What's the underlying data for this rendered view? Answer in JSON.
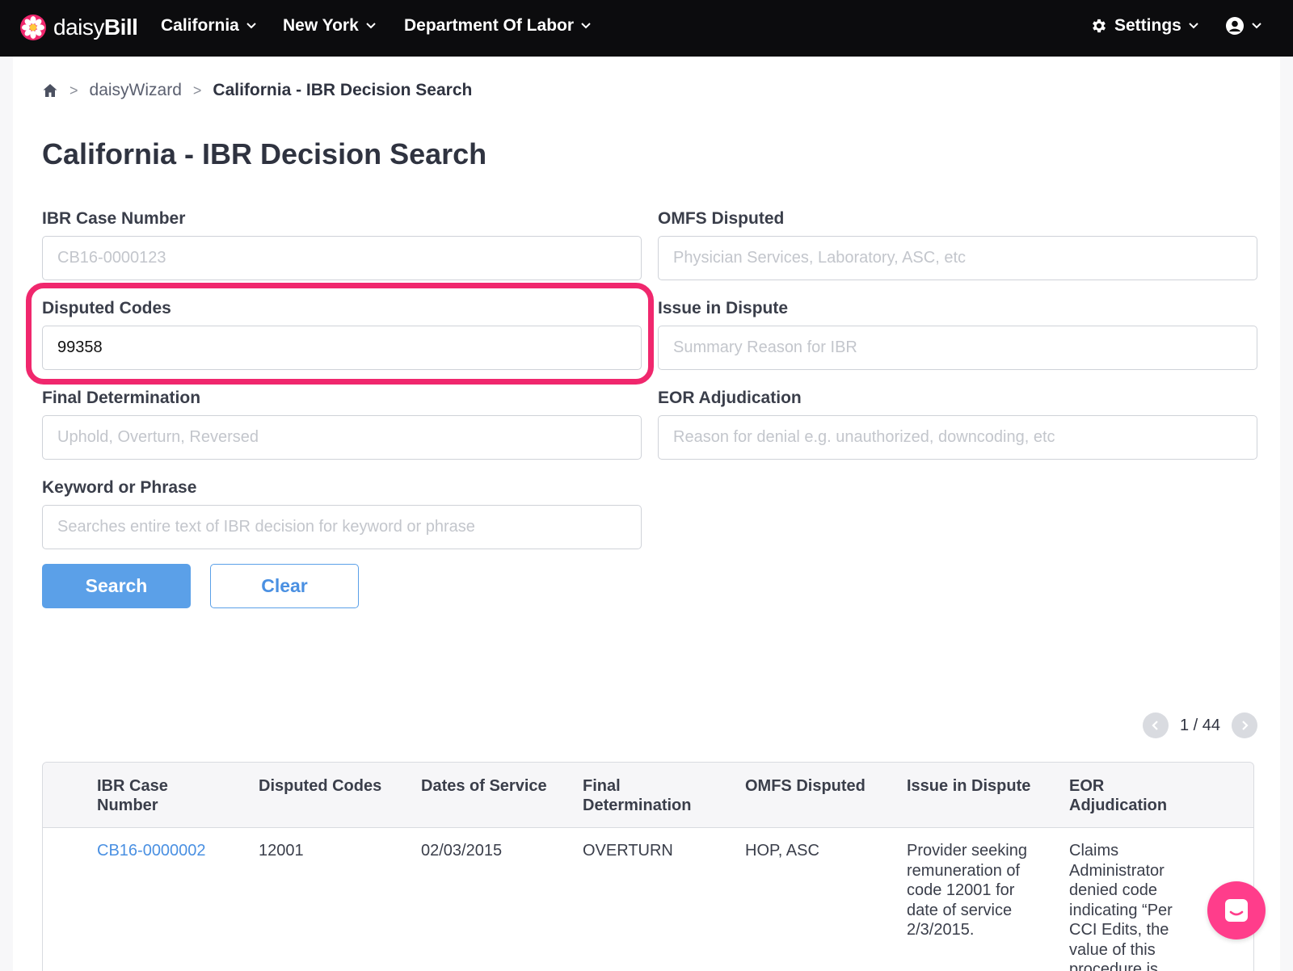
{
  "nav": {
    "brand_light": "daisy",
    "brand_bold": "Bill",
    "items": [
      {
        "label": "California"
      },
      {
        "label": "New York"
      },
      {
        "label": "Department Of Labor"
      }
    ],
    "settings_label": "Settings",
    "icons": {
      "settings": "gear-icon",
      "account": "user-circle-icon",
      "home": "home-icon"
    },
    "brand_color": "#f0276d"
  },
  "breadcrumb": {
    "items": [
      "daisyWizard",
      "California - IBR Decision Search"
    ]
  },
  "page": {
    "title": "California - IBR Decision Search"
  },
  "form": {
    "ibr_case_number": {
      "label": "IBR Case Number",
      "placeholder": "CB16-0000123",
      "value": ""
    },
    "omfs_disputed": {
      "label": "OMFS Disputed",
      "placeholder": "Physician Services, Laboratory, ASC, etc",
      "value": ""
    },
    "disputed_codes": {
      "label": "Disputed Codes",
      "placeholder": "",
      "value": "99358"
    },
    "issue_in_dispute": {
      "label": "Issue in Dispute",
      "placeholder": "Summary Reason for IBR",
      "value": ""
    },
    "final_determination": {
      "label": "Final Determination",
      "placeholder": "Uphold, Overturn, Reversed",
      "value": ""
    },
    "eor_adjudication": {
      "label": "EOR Adjudication",
      "placeholder": "Reason for denial e.g. unauthorized, downcoding, etc",
      "value": ""
    },
    "keyword": {
      "label": "Keyword or Phrase",
      "placeholder": "Searches entire text of IBR decision for keyword or phrase",
      "value": ""
    },
    "search_label": "Search",
    "clear_label": "Clear"
  },
  "pager": {
    "text": "1 / 44"
  },
  "table": {
    "headers": [
      {
        "line1": "IBR Case",
        "line2": "Number"
      },
      {
        "line1": "Disputed Codes",
        "line2": ""
      },
      {
        "line1": "Dates of Service",
        "line2": ""
      },
      {
        "line1": "Final",
        "line2": "Determination"
      },
      {
        "line1": "OMFS Disputed",
        "line2": ""
      },
      {
        "line1": "Issue in Dispute",
        "line2": ""
      },
      {
        "line1": "EOR",
        "line2": "Adjudication"
      }
    ],
    "rows": [
      {
        "case_number": "CB16-0000002",
        "disputed_codes": "12001",
        "dates_of_service": "02/03/2015",
        "final_determination": "OVERTURN",
        "omfs_disputed": "HOP, ASC",
        "issue_lines": [
          "Provider seeking",
          "remuneration of",
          "code 12001 for",
          "date of service",
          "2/3/2015."
        ],
        "eor_lines": [
          "Claims",
          "Administrator",
          "denied code",
          "indicating “Per",
          "CCI Edits, the",
          "value of this",
          "procedure is"
        ]
      }
    ]
  },
  "colors": {
    "accent": "#5ba0e8",
    "link": "#4a90e2",
    "highlight": "#f0276d",
    "chat": "#ff3d8b"
  }
}
